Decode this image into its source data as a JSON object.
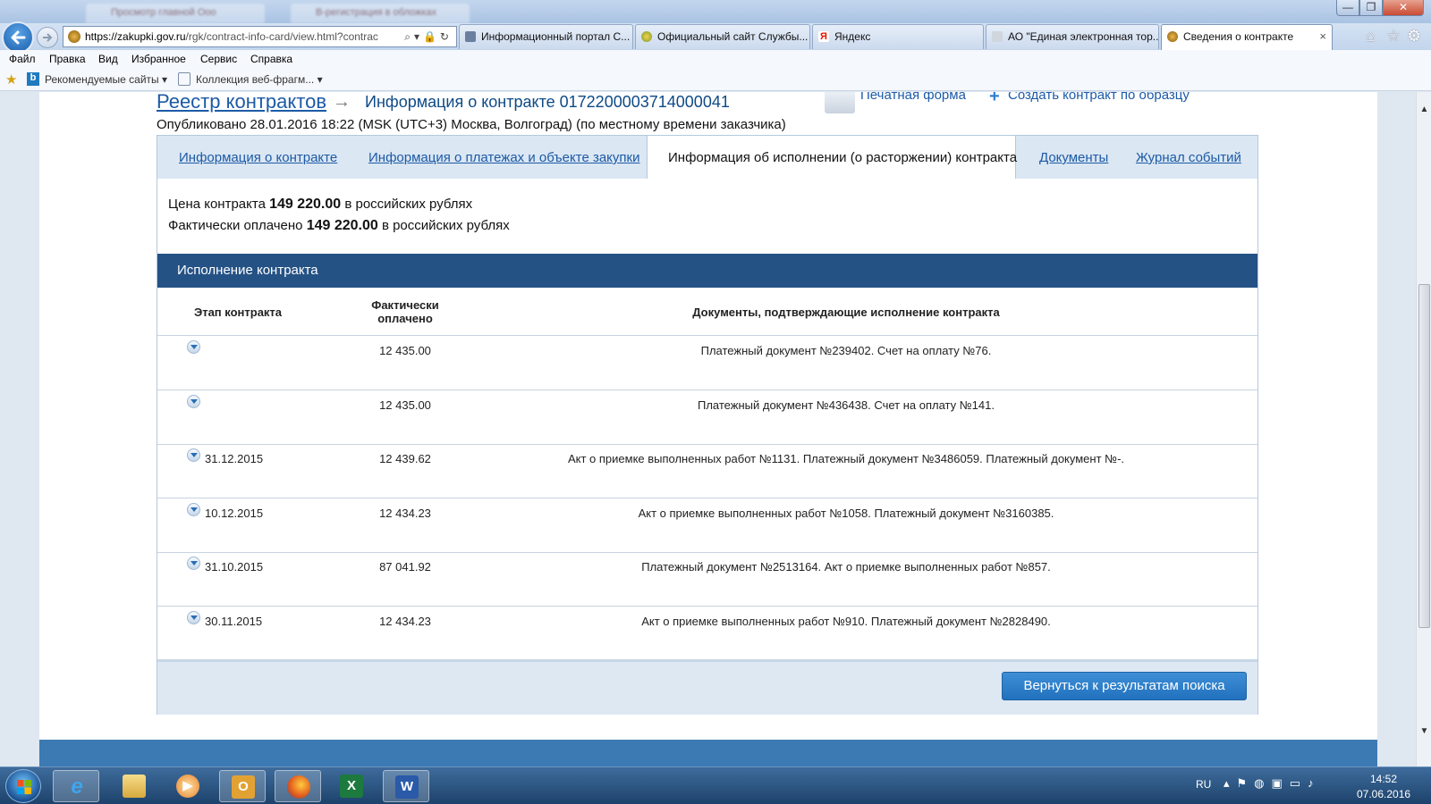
{
  "browser": {
    "background_tabs": [
      "Просмотр главной Ооо",
      "В-регистрация в обложках"
    ],
    "address": {
      "host": "https://zakupki.gov.ru",
      "path": "/rgk/contract-info-card/view.html?contrac"
    },
    "tabs": [
      {
        "label": "Информационный портал С...",
        "active": false
      },
      {
        "label": "Официальный сайт Службы...",
        "active": false
      },
      {
        "label": "Яндекс",
        "active": false
      },
      {
        "label": "АО \"Единая электронная тор...",
        "active": false
      },
      {
        "label": "Сведения о контракте",
        "active": true
      }
    ],
    "tab_close_glyph": "×",
    "menu": [
      "Файл",
      "Правка",
      "Вид",
      "Избранное",
      "Сервис",
      "Справка"
    ],
    "favorites": {
      "recommended": "Рекомендуемые сайты",
      "collection": "Коллекция веб-фрагм..."
    },
    "window_buttons": {
      "minimize": "—",
      "maximize": "❐",
      "close": "✕"
    }
  },
  "page": {
    "breadcrumb": {
      "root": "Реестр контрактов",
      "arrow": "→",
      "current": "Информация о контракте 0172200003714000041"
    },
    "actions": {
      "print_form": "Печатная форма",
      "create_icon": "+",
      "create_by_template": "Создать контракт по образцу"
    },
    "published": "Опубликовано 28.01.2016 18:22 (MSK (UTC+3) Москва, Волгоград) (по местному времени заказчика)",
    "tabs": [
      {
        "label": "Информация о контракте",
        "active": false
      },
      {
        "label": "Информация о платежах и объекте закупки",
        "active": false
      },
      {
        "label": "Информация об исполнении (о расторжении) контракта",
        "active": true
      },
      {
        "label": "Документы",
        "active": false
      },
      {
        "label": "Журнал событий",
        "active": false
      }
    ],
    "price": {
      "label": "Цена контракта",
      "value": "149 220.00",
      "currency": "в российских рублях"
    },
    "paid": {
      "label": "Фактически оплачено",
      "value": "149 220.00",
      "currency": "в российских рублях"
    },
    "execution": {
      "title": "Исполнение контракта",
      "columns": {
        "stage": "Этап контракта",
        "paid_line1": "Фактически",
        "paid_line2": "оплачено",
        "docs": "Документы, подтверждающие исполнение контракта"
      },
      "rows": [
        {
          "stage": "",
          "paid": "12 435.00",
          "docs": "Платежный документ №239402. Счет на оплату №76."
        },
        {
          "stage": "",
          "paid": "12 435.00",
          "docs": "Платежный документ №436438. Счет на оплату №141."
        },
        {
          "stage": "31.12.2015",
          "paid": "12 439.62",
          "docs": "Акт о приемке выполненных работ №1131. Платежный документ №3486059. Платежный документ №-."
        },
        {
          "stage": "10.12.2015",
          "paid": "12 434.23",
          "docs": "Акт о приемке выполненных работ №1058. Платежный документ №3160385."
        },
        {
          "stage": "31.10.2015",
          "paid": "87 041.92",
          "docs": "Платежный документ №2513164. Акт о приемке выполненных работ №857."
        },
        {
          "stage": "30.11.2015",
          "paid": "12 434.23",
          "docs": "Акт о приемке выполненных работ №910. Платежный документ №2828490."
        }
      ]
    },
    "back_button": "Вернуться к результатам поиска"
  },
  "taskbar": {
    "apps": [
      "internet-explorer",
      "file-explorer",
      "media-player",
      "outlook",
      "firefox",
      "excel",
      "word"
    ],
    "language": "RU",
    "time": "14:52",
    "date": "07.06.2016"
  },
  "colors": {
    "link": "#1c5aa6",
    "section_header": "#245285",
    "button": "#2271be",
    "taskbar": "#1d426b"
  }
}
